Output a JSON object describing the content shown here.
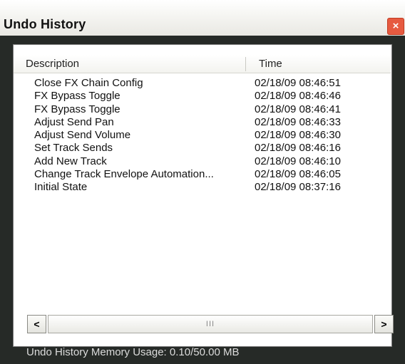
{
  "window": {
    "title": "Undo History",
    "close_glyph": "×"
  },
  "list": {
    "columns": {
      "description": "Description",
      "time": "Time"
    },
    "rows": [
      {
        "description": "Close FX Chain Config",
        "time": "02/18/09 08:46:51"
      },
      {
        "description": "FX Bypass Toggle",
        "time": "02/18/09 08:46:46"
      },
      {
        "description": "FX Bypass Toggle",
        "time": "02/18/09 08:46:41"
      },
      {
        "description": "Adjust Send Pan",
        "time": "02/18/09 08:46:33"
      },
      {
        "description": "Adjust Send Volume",
        "time": "02/18/09 08:46:30"
      },
      {
        "description": "Set Track Sends",
        "time": "02/18/09 08:46:16"
      },
      {
        "description": "Add New Track",
        "time": "02/18/09 08:46:10"
      },
      {
        "description": "Change Track Envelope Automation...",
        "time": "02/18/09 08:46:05"
      },
      {
        "description": "Initial State",
        "time": "02/18/09 08:37:16"
      }
    ]
  },
  "scrollbar": {
    "left_glyph": "<",
    "right_glyph": ">",
    "thumb_grip": "III"
  },
  "status": {
    "memory": "Undo History Memory Usage: 0.10/50.00 MB"
  },
  "colors": {
    "background": "#262a27",
    "close_button": "#e65a40"
  }
}
